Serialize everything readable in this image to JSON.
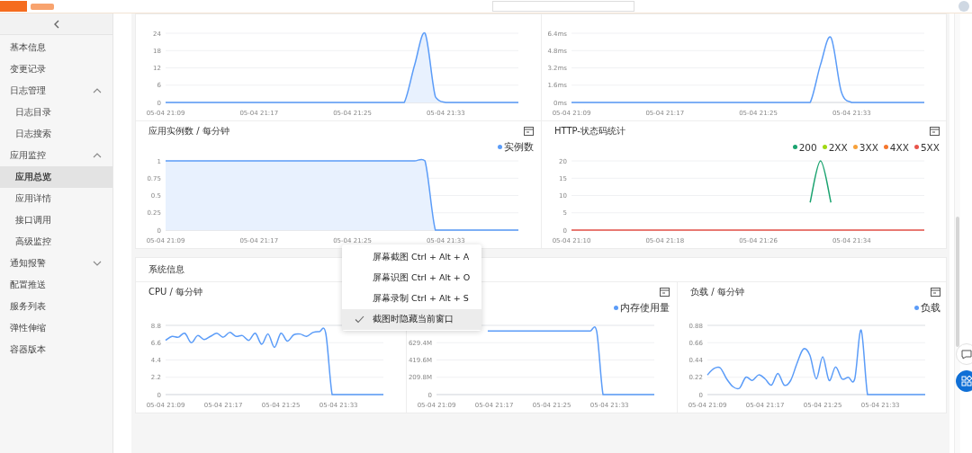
{
  "sidebar": {
    "items": [
      {
        "label": "基本信息",
        "selected": false
      },
      {
        "label": "变更记录",
        "selected": false
      },
      {
        "label": "日志管理",
        "selected": false,
        "expanded": true,
        "children": [
          {
            "label": "日志目录",
            "selected": false
          },
          {
            "label": "日志搜索",
            "selected": false
          }
        ]
      },
      {
        "label": "应用监控",
        "selected": false,
        "expanded": true,
        "children": [
          {
            "label": "应用总览",
            "selected": true
          },
          {
            "label": "应用详情",
            "selected": false
          },
          {
            "label": "接口调用",
            "selected": false
          },
          {
            "label": "高级监控",
            "selected": false
          }
        ]
      },
      {
        "label": "通知报警",
        "selected": false,
        "expanded": false
      },
      {
        "label": "配置推送",
        "selected": false
      },
      {
        "label": "服务列表",
        "selected": false
      },
      {
        "label": "弹性伸缩",
        "selected": false
      },
      {
        "label": "容器版本",
        "selected": false
      }
    ]
  },
  "monitor_rows": [
    {
      "charts": [
        {
          "has_icon": false,
          "chart_data": {
            "type": "area",
            "categories": [
              "05-04 21:09",
              null,
              null,
              null,
              null,
              null,
              null,
              null,
              null,
              "05-04 21:17",
              null,
              null,
              null,
              null,
              null,
              null,
              null,
              null,
              "05-04 21:25",
              null,
              null,
              null,
              null,
              null,
              null,
              null,
              null,
              "05-04 21:33",
              null,
              null,
              null,
              null,
              null,
              null,
              null
            ],
            "grid": true,
            "ylim": [
              0,
              24
            ],
            "yticks": [
              0,
              6,
              12,
              18,
              24
            ],
            "series": [
              {
                "color": "#5b9cf8",
                "values": [
                  0,
                  0,
                  0,
                  0,
                  0,
                  0,
                  0,
                  0,
                  0,
                  0,
                  0,
                  0,
                  0,
                  0,
                  0,
                  0,
                  0,
                  0,
                  0,
                  0,
                  0,
                  0,
                  0,
                  0,
                  13,
                  24,
                  2,
                  0,
                  0,
                  0,
                  0,
                  0,
                  0,
                  0,
                  0
                ]
              }
            ]
          }
        },
        {
          "has_icon": false,
          "chart_data": {
            "type": "line",
            "categories": [
              "05-04 21:09",
              null,
              null,
              null,
              null,
              null,
              null,
              null,
              null,
              "05-04 21:17",
              null,
              null,
              null,
              null,
              null,
              null,
              null,
              null,
              "05-04 21:25",
              null,
              null,
              null,
              null,
              null,
              null,
              null,
              null,
              "05-04 21:33",
              null,
              null,
              null,
              null,
              null,
              null,
              null
            ],
            "grid": true,
            "ylim": [
              0,
              6.4
            ],
            "yticks": [
              {
                "value": 0,
                "label": "0ms"
              },
              {
                "value": 1.6,
                "label": "1.6ms"
              },
              {
                "value": 3.2,
                "label": "3.2ms"
              },
              {
                "value": 4.8,
                "label": "4.8ms"
              },
              {
                "value": 6.4,
                "label": "6.4ms"
              }
            ],
            "series": [
              {
                "color": "#5b9cf8",
                "values": [
                  0,
                  0,
                  0,
                  0,
                  0,
                  0,
                  0,
                  0,
                  0,
                  0,
                  0,
                  0,
                  0,
                  0,
                  0,
                  0,
                  0,
                  0,
                  0,
                  0,
                  0,
                  0,
                  0,
                  0,
                  3.5,
                  6.0,
                  1,
                  0,
                  0,
                  0,
                  0,
                  0,
                  0,
                  0,
                  0
                ]
              }
            ]
          }
        }
      ]
    },
    {
      "charts": [
        {
          "has_icon": true,
          "chart_data": {
            "type": "area",
            "title": "应用实例数 / 每分钟",
            "categories": [
              "05-04 21:09",
              null,
              null,
              null,
              null,
              null,
              null,
              null,
              null,
              "05-04 21:17",
              null,
              null,
              null,
              null,
              null,
              null,
              null,
              null,
              "05-04 21:25",
              null,
              null,
              null,
              null,
              null,
              null,
              null,
              null,
              "05-04 21:33",
              null,
              null,
              null,
              null,
              null,
              null,
              null
            ],
            "grid": true,
            "ylim": [
              0,
              1
            ],
            "yticks": [
              0,
              0.25,
              0.5,
              0.75,
              1
            ],
            "series": [
              {
                "name": "实例数",
                "color": "#5b9cf8",
                "values": [
                  1,
                  1,
                  1,
                  1,
                  1,
                  1,
                  1,
                  1,
                  1,
                  1,
                  1,
                  1,
                  1,
                  1,
                  1,
                  1,
                  1,
                  1,
                  1,
                  1,
                  1,
                  1,
                  1,
                  1,
                  1,
                  1,
                  0,
                  0,
                  0,
                  0,
                  0,
                  0,
                  0,
                  0,
                  0
                ]
              }
            ]
          }
        },
        {
          "has_icon": true,
          "chart_data": {
            "type": "line",
            "title": "HTTP-状态码统计",
            "categories": [
              "05-04 21:10",
              null,
              null,
              null,
              null,
              null,
              null,
              null,
              null,
              "05-04 21:18",
              null,
              null,
              null,
              null,
              null,
              null,
              null,
              null,
              "05-04 21:26",
              null,
              null,
              null,
              null,
              null,
              null,
              null,
              null,
              "05-04 21:34",
              null,
              null,
              null,
              null,
              null,
              null,
              null
            ],
            "grid": true,
            "ylim": [
              0,
              20
            ],
            "yticks": [
              0,
              5,
              10,
              15,
              20
            ],
            "series": [
              {
                "name": "200",
                "color": "#1aa36f",
                "values": [
                  null,
                  null,
                  null,
                  null,
                  null,
                  null,
                  null,
                  null,
                  null,
                  null,
                  null,
                  null,
                  null,
                  null,
                  null,
                  null,
                  null,
                  null,
                  null,
                  null,
                  null,
                  null,
                  null,
                  8,
                  20,
                  8,
                  null,
                  null,
                  null,
                  null,
                  null,
                  null,
                  null,
                  null,
                  null
                ]
              },
              {
                "name": "2XX",
                "color": "#a0d911",
                "values": [
                  null,
                  null,
                  null,
                  null,
                  null,
                  null,
                  null,
                  null,
                  null,
                  null,
                  null,
                  null,
                  null,
                  null,
                  null,
                  null,
                  null,
                  null,
                  null,
                  null,
                  null,
                  null,
                  null,
                  null,
                  null,
                  null,
                  null,
                  null,
                  null,
                  null,
                  null,
                  null,
                  null,
                  null,
                  null
                ]
              },
              {
                "name": "3XX",
                "color": "#f7a13a",
                "values": [
                  null,
                  null,
                  null,
                  null,
                  null,
                  null,
                  null,
                  null,
                  null,
                  null,
                  null,
                  null,
                  null,
                  null,
                  null,
                  null,
                  null,
                  null,
                  null,
                  null,
                  null,
                  null,
                  null,
                  null,
                  null,
                  null,
                  null,
                  null,
                  null,
                  null,
                  null,
                  null,
                  null,
                  null,
                  null
                ]
              },
              {
                "name": "4XX",
                "color": "#f5762d",
                "values": [
                  null,
                  null,
                  null,
                  null,
                  null,
                  null,
                  null,
                  null,
                  null,
                  null,
                  null,
                  null,
                  null,
                  null,
                  null,
                  null,
                  null,
                  null,
                  null,
                  null,
                  null,
                  null,
                  null,
                  null,
                  null,
                  null,
                  null,
                  null,
                  null,
                  null,
                  null,
                  null,
                  null,
                  null,
                  null
                ]
              },
              {
                "name": "5XX",
                "color": "#e8534a",
                "values": [
                  0,
                  0,
                  0,
                  0,
                  0,
                  0,
                  0,
                  0,
                  0,
                  0,
                  0,
                  0,
                  0,
                  0,
                  0,
                  0,
                  0,
                  0,
                  0,
                  0,
                  0,
                  0,
                  0,
                  0,
                  0,
                  0,
                  0,
                  0,
                  0,
                  0,
                  0,
                  0,
                  0,
                  0,
                  0
                ]
              }
            ]
          }
        }
      ]
    }
  ],
  "system_info": {
    "title": "系统信息",
    "charts": [
      {
        "has_icon": false,
        "chart_data": {
          "type": "line",
          "title": "CPU / 每分钟",
          "categories": [
            "05-04 21:09",
            null,
            null,
            null,
            null,
            null,
            null,
            null,
            null,
            "05-04 21:17",
            null,
            null,
            null,
            null,
            null,
            null,
            null,
            null,
            "05-04 21:25",
            null,
            null,
            null,
            null,
            null,
            null,
            null,
            null,
            "05-04 21:33",
            null,
            null,
            null,
            null,
            null,
            null,
            null
          ],
          "grid": true,
          "ylim": [
            0,
            8.8
          ],
          "yticks": [
            0,
            2.2,
            4.4,
            6.6,
            8.8
          ],
          "series": [
            {
              "color": "#5b9cf8",
              "values": [
                6.9,
                7.4,
                7.3,
                7.8,
                6.6,
                7.5,
                7.0,
                7.4,
                7.8,
                7.3,
                7.9,
                7.4,
                7.5,
                6.9,
                7.8,
                6.4,
                7.7,
                6.0,
                7.8,
                6.8,
                7.6,
                7.7,
                7.4,
                7.9,
                8.0,
                7.8,
                0,
                0,
                0,
                0,
                0,
                0,
                0,
                0,
                0
              ]
            }
          ]
        }
      },
      {
        "has_icon": true,
        "chart_data": {
          "type": "line",
          "categories": [
            "05-04 21:09",
            null,
            null,
            null,
            null,
            null,
            null,
            null,
            null,
            "05-04 21:17",
            null,
            null,
            null,
            null,
            null,
            null,
            null,
            null,
            "05-04 21:25",
            null,
            null,
            null,
            null,
            null,
            null,
            null,
            null,
            "05-04 21:33",
            null,
            null,
            null,
            null,
            null,
            null,
            null
          ],
          "grid": true,
          "ylim": [
            0,
            839.2
          ],
          "yticks": [
            {
              "value": 0,
              "label": "0"
            },
            {
              "value": 209.8,
              "label": "209.8M"
            },
            {
              "value": 419.6,
              "label": "419.6M"
            },
            {
              "value": 629.4,
              "label": "629.4M"
            }
          ],
          "series": [
            {
              "name": "内存使用量",
              "color": "#5b9cf8",
              "values": [
                null,
                null,
                null,
                null,
                null,
                null,
                null,
                null,
                770,
                770,
                770,
                770,
                770,
                770,
                770,
                770,
                770,
                770,
                770,
                770,
                770,
                770,
                770,
                770,
                770,
                770,
                0,
                0,
                0,
                0,
                0,
                0,
                0,
                0,
                0
              ]
            }
          ]
        }
      },
      {
        "has_icon": true,
        "chart_data": {
          "type": "line",
          "title": "负载 / 每分钟",
          "categories": [
            "05-04 21:09",
            null,
            null,
            null,
            null,
            null,
            null,
            null,
            null,
            "05-04 21:17",
            null,
            null,
            null,
            null,
            null,
            null,
            null,
            null,
            "05-04 21:25",
            null,
            null,
            null,
            null,
            null,
            null,
            null,
            null,
            "05-04 21:33",
            null,
            null,
            null,
            null,
            null,
            null,
            null
          ],
          "grid": true,
          "ylim": [
            0,
            0.88
          ],
          "yticks": [
            0,
            0.22,
            0.44,
            0.66,
            0.88
          ],
          "series": [
            {
              "name": "负载",
              "color": "#5b9cf8",
              "values": [
                0.25,
                0.33,
                0.34,
                0.2,
                0.1,
                0.08,
                0.22,
                0.18,
                0.25,
                0.2,
                0.12,
                0.27,
                0.12,
                0.18,
                0.4,
                0.58,
                0.5,
                0.2,
                0.48,
                0.18,
                0.35,
                0.2,
                0.22,
                0.2,
                0.82,
                0,
                0,
                0,
                0,
                0,
                0,
                0,
                0,
                0,
                0
              ]
            }
          ]
        }
      }
    ]
  },
  "context_menu": {
    "items": [
      {
        "label": "屏幕截图 Ctrl + Alt + A",
        "checked": false,
        "highlighted": false
      },
      {
        "label": "屏幕识图 Ctrl + Alt + O",
        "checked": false,
        "highlighted": false
      },
      {
        "label": "屏幕录制 Ctrl + Alt + S",
        "checked": false,
        "highlighted": false
      },
      {
        "label": "截图时隐藏当前窗口",
        "checked": true,
        "highlighted": true
      }
    ]
  }
}
